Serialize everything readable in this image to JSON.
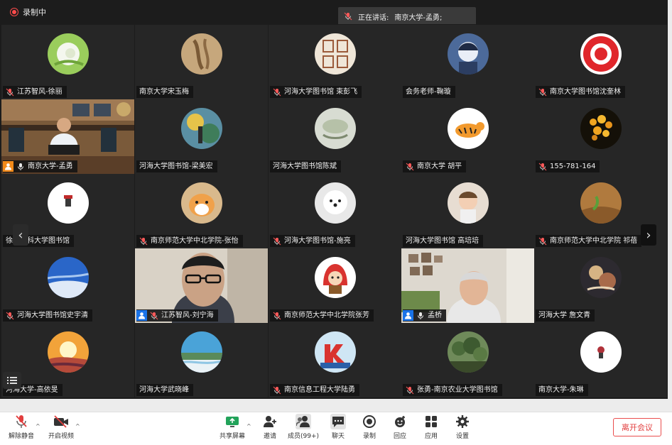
{
  "window": {
    "recording_label": "录制中",
    "speaking_label": "正在讲话:",
    "speaking_name": "南京大学-孟勇;"
  },
  "colors": {
    "active_speaker": "#2bd16b",
    "host_badge": "#1a73e8",
    "leave_red": "#e23e3e",
    "record_red": "#ff4b4b"
  },
  "participants": [
    {
      "name": "江苏智风-徐丽",
      "mic_icon": "mic-muted-icon"
    },
    {
      "name": "南京大学宋玉梅",
      "mic_icon": ""
    },
    {
      "name": "河海大学图书馆 束彭飞",
      "mic_icon": "mic-muted-icon"
    },
    {
      "name": "会务老师-鞠璇",
      "mic_icon": ""
    },
    {
      "name": "南京大学图书馆沈奎林",
      "mic_icon": "mic-muted-icon"
    },
    {
      "name": "南京大学-孟勇",
      "mic_icon": "mic-icon",
      "badge": "host-icon"
    },
    {
      "name": "河海大学图书馆-梁美宏",
      "mic_icon": ""
    },
    {
      "name": "河海大学图书馆陈斌",
      "mic_icon": ""
    },
    {
      "name": "南京大学 胡平",
      "mic_icon": "mic-muted-icon"
    },
    {
      "name": "155-781-164",
      "mic_icon": "mic-muted-icon"
    },
    {
      "name": "徐州医科大学图书馆",
      "mic_icon": ""
    },
    {
      "name": "南京师范大学中北学院-张怡",
      "mic_icon": "mic-muted-icon"
    },
    {
      "name": "河海大学图书馆-施亮",
      "mic_icon": "mic-muted-icon"
    },
    {
      "name": "河海大学图书馆 高培培",
      "mic_icon": ""
    },
    {
      "name": "南京师范大学中北学院 祁蓓",
      "mic_icon": "mic-muted-icon"
    },
    {
      "name": "河海大学图书馆史宇清",
      "mic_icon": "mic-muted-icon"
    },
    {
      "name": "江苏智风-刘宁海",
      "mic_icon": "mic-muted-icon",
      "badge": "host-icon"
    },
    {
      "name": "南京师范大学中北学院张芳",
      "mic_icon": "mic-muted-icon"
    },
    {
      "name": "孟桥",
      "mic_icon": "mic-icon",
      "badge": "host-icon"
    },
    {
      "name": "河海大学 詹文青",
      "mic_icon": ""
    },
    {
      "name": "河海大学-高依旻",
      "mic_icon": ""
    },
    {
      "name": "河海大学武晓峰",
      "mic_icon": ""
    },
    {
      "name": "南京信息工程大学陆勇",
      "mic_icon": "mic-muted-icon"
    },
    {
      "name": "张勇-南京农业大学图书馆",
      "mic_icon": "mic-muted-icon"
    },
    {
      "name": "南京大学-朱琳",
      "mic_icon": ""
    }
  ],
  "toolbar": {
    "unmute": "解除静音",
    "start_video": "开启视频",
    "share_screen": "共享屏幕",
    "invite": "邀请",
    "members": "成员(99+)",
    "chat": "聊天",
    "record": "录制",
    "applause": "回应",
    "apps": "应用",
    "settings": "设置",
    "leave": "离开会议"
  }
}
